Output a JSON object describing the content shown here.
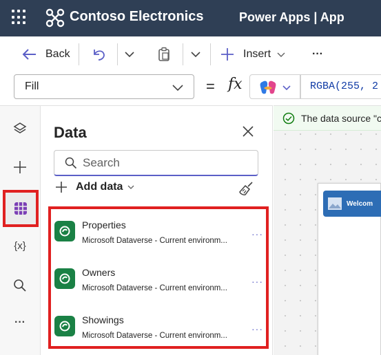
{
  "topbar": {
    "brand": "Contoso Electronics",
    "app_title": "Power Apps  |  App"
  },
  "commandbar": {
    "back_label": "Back",
    "insert_label": "Insert",
    "more_label": "···"
  },
  "formula": {
    "property": "Fill",
    "equals": "=",
    "fx": "fx",
    "value": "RGBA(255, 2"
  },
  "rail": {
    "items": [
      "tree-view",
      "insert",
      "data",
      "variables",
      "search",
      "more"
    ],
    "variables_label": "{x}",
    "more_label": "···"
  },
  "data_pane": {
    "title": "Data",
    "search_placeholder": "Search",
    "add_data_label": "Add data",
    "sources": [
      {
        "name": "Properties",
        "description": "Microsoft Dataverse - Current environm...",
        "more": "···"
      },
      {
        "name": "Owners",
        "description": "Microsoft Dataverse - Current environm...",
        "more": "···"
      },
      {
        "name": "Showings",
        "description": "Microsoft Dataverse - Current environm...",
        "more": "···"
      }
    ]
  },
  "canvas": {
    "notice": "The data source \"c",
    "screen_header": "Welcom"
  },
  "colors": {
    "topbar": "#2f3f55",
    "highlight": "#e02020",
    "dataverse": "#1a8145",
    "accent": "#5b5fc7"
  }
}
